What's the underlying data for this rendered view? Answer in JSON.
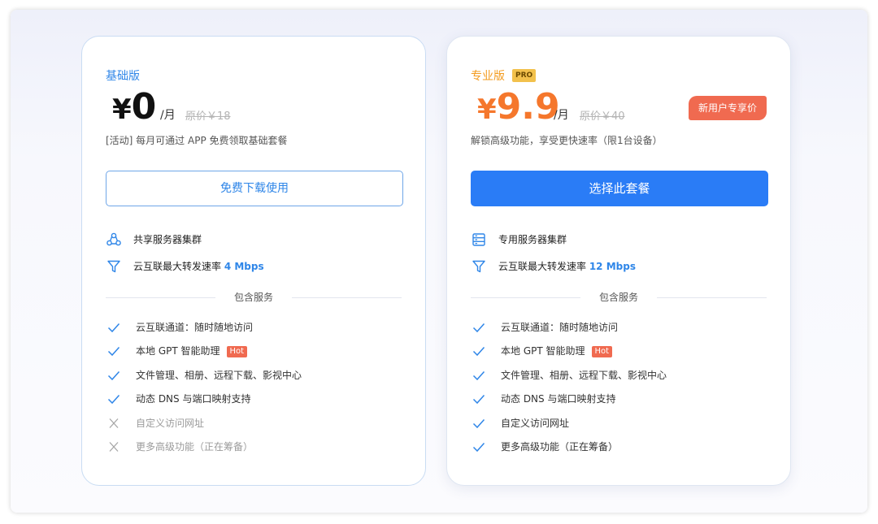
{
  "basic": {
    "name": "基础版",
    "currency": "¥",
    "price": "0",
    "per": "/月",
    "original": "原价￥18",
    "desc": "[活动] 每月可通过 APP 免费领取基础套餐",
    "button": "免费下载使用",
    "features": [
      {
        "text": "共享服务器集群",
        "icon": "cluster-icon"
      },
      {
        "text": "云互联最大转发速率 ",
        "speed": "4 Mbps",
        "icon": "funnel-icon"
      }
    ],
    "divider": "包含服务",
    "services": [
      {
        "text": "云互联通道：随时随地访问",
        "ok": true
      },
      {
        "text": "本地 GPT 智能助理",
        "ok": true,
        "tag": "Hot"
      },
      {
        "text": "文件管理、相册、远程下载、影视中心",
        "ok": true
      },
      {
        "text": "动态 DNS 与端口映射支持",
        "ok": true
      },
      {
        "text": "自定义访问网址",
        "ok": false
      },
      {
        "text": "更多高级功能（正在筹备）",
        "ok": false
      }
    ]
  },
  "pro": {
    "name": "专业版",
    "badge": "PRO",
    "currency": "¥",
    "price": "9.9",
    "per": "/月",
    "original": "原价￥40",
    "promo": "新用户专享价",
    "desc": "解锁高级功能，享受更快速率（限1台设备）",
    "button": "选择此套餐",
    "features": [
      {
        "text": "专用服务器集群",
        "icon": "server-icon"
      },
      {
        "text": "云互联最大转发速率 ",
        "speed": "12 Mbps",
        "icon": "funnel-icon"
      }
    ],
    "divider": "包含服务",
    "services": [
      {
        "text": "云互联通道：随时随地访问",
        "ok": true
      },
      {
        "text": "本地 GPT 智能助理",
        "ok": true,
        "tag": "Hot"
      },
      {
        "text": "文件管理、相册、远程下载、影视中心",
        "ok": true
      },
      {
        "text": "动态 DNS 与端口映射支持",
        "ok": true
      },
      {
        "text": "自定义访问网址",
        "ok": true
      },
      {
        "text": "更多高级功能（正在筹备）",
        "ok": true
      }
    ]
  },
  "colors": {
    "blue": "#2f86e8",
    "button_blue": "#2a7cf6",
    "orange": "#f5772c",
    "gold": "#f39b1e",
    "hot": "#f06a50"
  }
}
